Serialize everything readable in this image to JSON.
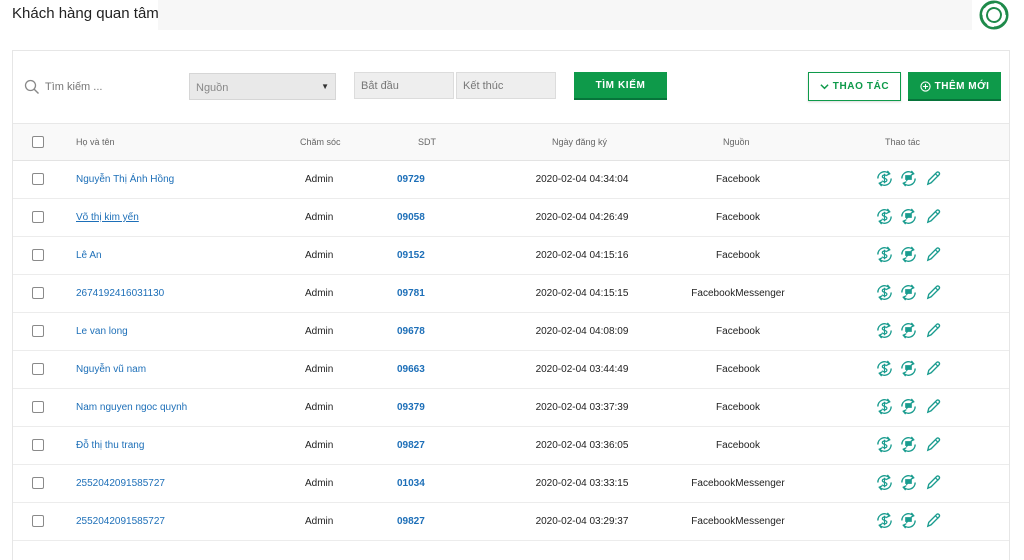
{
  "header": {
    "title": "Khách hàng quan tâm"
  },
  "toolbar": {
    "search_placeholder": "Tìm kiếm ...",
    "source_select": "Nguồn",
    "start_placeholder": "Bắt đầu",
    "end_placeholder": "Kết thúc",
    "search_button": "TÌM KIẾM",
    "actions_button": "THAO TÁC",
    "add_button": "THÊM MỚI"
  },
  "table": {
    "columns": {
      "name": "Họ và tên",
      "care": "Chăm sóc",
      "phone": "SDT",
      "date": "Ngày đăng ký",
      "source": "Nguồn",
      "actions": "Thao tác"
    },
    "rows": [
      {
        "name": "Nguyễn Thị Ánh Hồng",
        "care": "Admin",
        "phone": "09729",
        "date": "2020-02-04 04:34:04",
        "source": "Facebook"
      },
      {
        "name": "Võ thị kim yến",
        "care": "Admin",
        "phone": "09058",
        "date": "2020-02-04 04:26:49",
        "source": "Facebook"
      },
      {
        "name": "Lê An",
        "care": "Admin",
        "phone": "09152",
        "date": "2020-02-04 04:15:16",
        "source": "Facebook"
      },
      {
        "name": "2674192416031130",
        "care": "Admin",
        "phone": "09781",
        "date": "2020-02-04 04:15:15",
        "source": "FacebookMessenger"
      },
      {
        "name": "Le van long",
        "care": "Admin",
        "phone": "09678",
        "date": "2020-02-04 04:08:09",
        "source": "Facebook"
      },
      {
        "name": "Nguyễn vũ nam",
        "care": "Admin",
        "phone": "09663",
        "date": "2020-02-04 03:44:49",
        "source": "Facebook"
      },
      {
        "name": "Nam nguyen ngoc quynh",
        "care": "Admin",
        "phone": "09379",
        "date": "2020-02-04 03:37:39",
        "source": "Facebook"
      },
      {
        "name": "Đỗ thị thu trang",
        "care": "Admin",
        "phone": "09827",
        "date": "2020-02-04 03:36:05",
        "source": "Facebook"
      },
      {
        "name": "2552042091585727",
        "care": "Admin",
        "phone": "01034",
        "date": "2020-02-04 03:33:15",
        "source": "FacebookMessenger"
      },
      {
        "name": "2552042091585727",
        "care": "Admin",
        "phone": "09827",
        "date": "2020-02-04 03:29:37",
        "source": "FacebookMessenger"
      }
    ]
  },
  "icons": {
    "help": "lifebuoy-icon",
    "search": "search-icon",
    "row_actions": [
      "dollar-refresh-icon",
      "chat-refresh-icon",
      "pencil-icon"
    ]
  },
  "colors": {
    "accent": "#0e9a4a",
    "link": "#1d6fb8"
  }
}
